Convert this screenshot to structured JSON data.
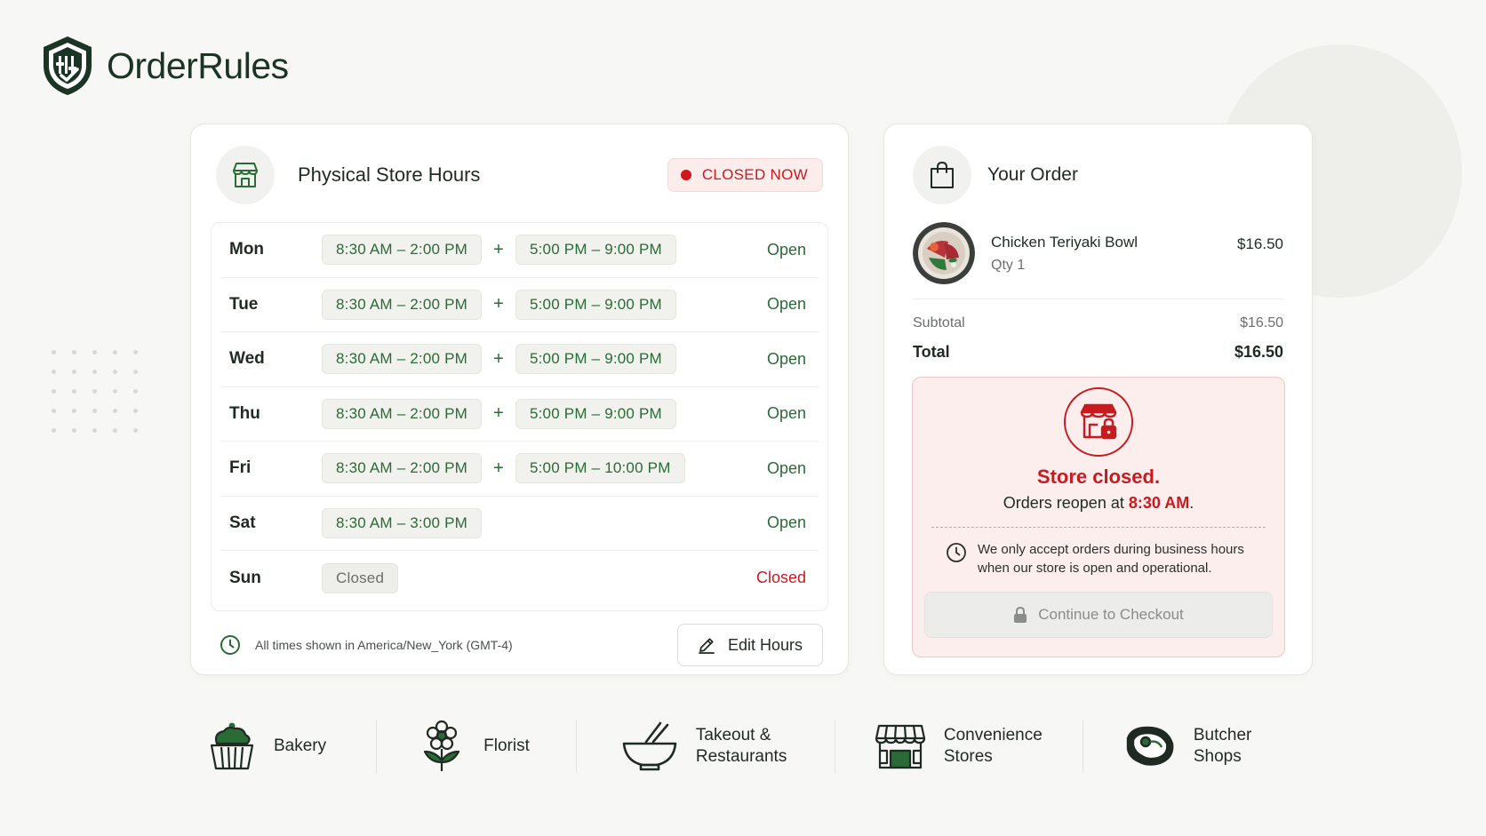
{
  "brand": {
    "name": "OrderRules"
  },
  "hours": {
    "title": "Physical Store Hours",
    "status": "CLOSED NOW",
    "rows": [
      {
        "day": "Mon",
        "slots": [
          "8:30 AM – 2:00 PM",
          "5:00 PM – 9:00 PM"
        ],
        "status": "Open"
      },
      {
        "day": "Tue",
        "slots": [
          "8:30 AM – 2:00 PM",
          "5:00 PM – 9:00 PM"
        ],
        "status": "Open"
      },
      {
        "day": "Wed",
        "slots": [
          "8:30 AM – 2:00 PM",
          "5:00 PM – 9:00 PM"
        ],
        "status": "Open"
      },
      {
        "day": "Thu",
        "slots": [
          "8:30 AM – 2:00 PM",
          "5:00 PM – 9:00 PM"
        ],
        "status": "Open"
      },
      {
        "day": "Fri",
        "slots": [
          "8:30 AM – 2:00 PM",
          "5:00 PM – 10:00 PM"
        ],
        "status": "Open"
      },
      {
        "day": "Sat",
        "slots": [
          "8:30 AM – 3:00 PM"
        ],
        "status": "Open"
      },
      {
        "day": "Sun",
        "slots": [
          "Closed"
        ],
        "status": "Closed"
      }
    ],
    "plus": "+",
    "timezone_note": "All times shown in America/New_York (GMT-4)",
    "edit_label": "Edit Hours"
  },
  "order": {
    "title": "Your Order",
    "item": {
      "name": "Chicken Teriyaki Bowl",
      "qty": "Qty 1",
      "price": "$16.50"
    },
    "subtotal_label": "Subtotal",
    "subtotal": "$16.50",
    "total_label": "Total",
    "total": "$16.50",
    "closed_title": "Store closed.",
    "reopen_prefix": "Orders reopen at",
    "reopen_time": "8:30 AM",
    "reopen_suffix": ".",
    "notice": "We only accept orders during business hours when our store is open and operational.",
    "checkout_label": "Continue to Checkout"
  },
  "categories": [
    {
      "label": "Bakery",
      "icon": "cupcake-icon"
    },
    {
      "label": "Florist",
      "icon": "flower-icon"
    },
    {
      "label": "Takeout & Restaurants",
      "icon": "bowl-chopsticks-icon"
    },
    {
      "label": "Convenience Stores",
      "icon": "storefront-24-icon"
    },
    {
      "label": "Butcher Shops",
      "icon": "steak-icon"
    }
  ],
  "colors": {
    "brand_green": "#1c3424",
    "accent_green": "#2a6a36",
    "closed_red": "#c81b1f"
  }
}
